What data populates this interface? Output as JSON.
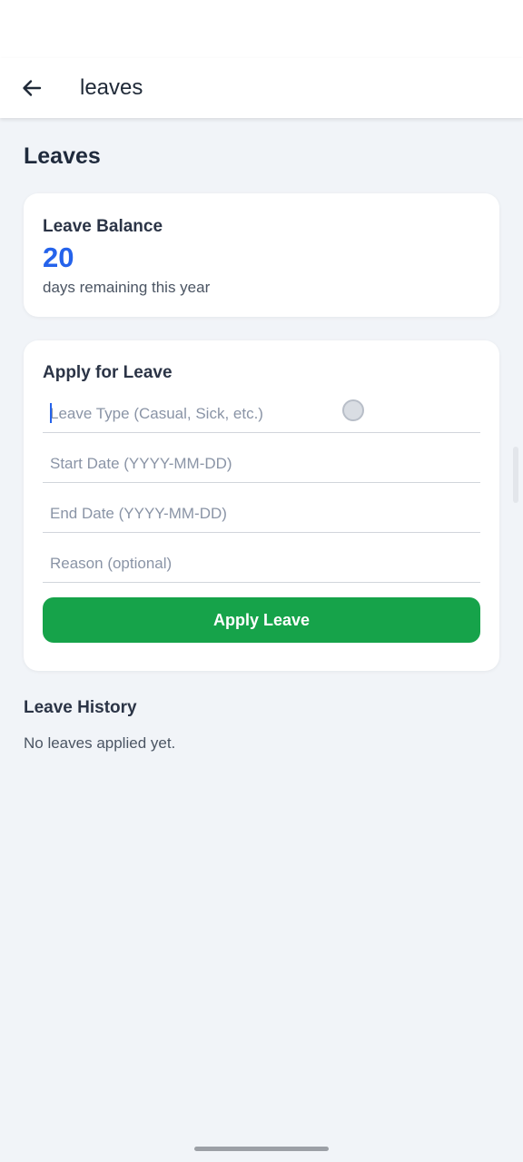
{
  "app_bar": {
    "title": "leaves"
  },
  "page": {
    "title": "Leaves"
  },
  "balance": {
    "label": "Leave Balance",
    "value": "20",
    "subtitle": "days remaining this year"
  },
  "apply": {
    "title": "Apply for Leave",
    "fields": {
      "leave_type": {
        "value": "",
        "placeholder": "Leave Type (Casual, Sick, etc.)"
      },
      "start_date": {
        "value": "",
        "placeholder": "Start Date (YYYY-MM-DD)"
      },
      "end_date": {
        "value": "",
        "placeholder": "End Date (YYYY-MM-DD)"
      },
      "reason": {
        "value": "",
        "placeholder": "Reason (optional)"
      }
    },
    "button_label": "Apply Leave"
  },
  "history": {
    "title": "Leave History",
    "empty_text": "No leaves applied yet."
  },
  "icons": {
    "back": "arrow-left-icon"
  },
  "colors": {
    "accent_blue": "#2563eb",
    "button_green": "#16a34a",
    "background": "#f1f4f8"
  }
}
